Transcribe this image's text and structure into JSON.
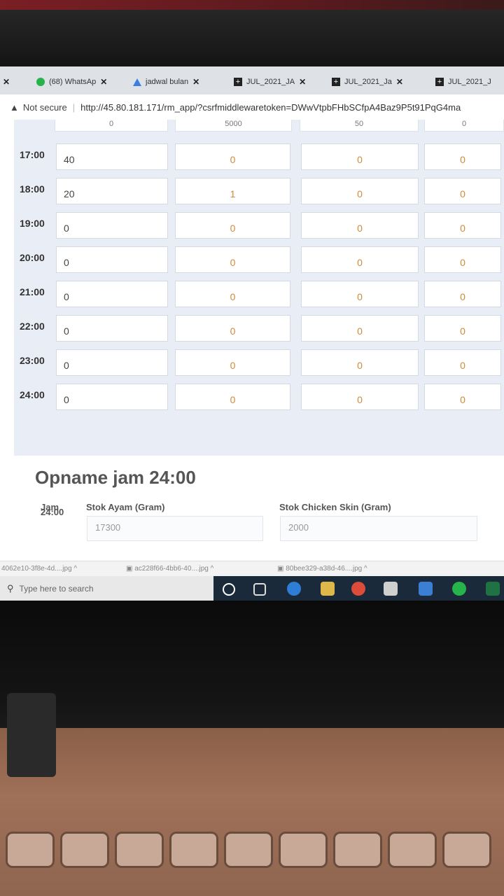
{
  "browser": {
    "tabs": [
      {
        "title": "(68) WhatsAp",
        "icon": "whatsapp-icon"
      },
      {
        "title": "jadwal bulan",
        "icon": "google-drive-icon"
      },
      {
        "title": "JUL_2021_JA",
        "icon": "plus-icon"
      },
      {
        "title": "JUL_2021_Ja",
        "icon": "plus-icon"
      },
      {
        "title": "JUL_2021_J",
        "icon": "plus-icon"
      }
    ],
    "security_label": "Not secure",
    "url": "http://45.80.181.171/rm_app/?csrfmiddlewaretoken=DWwVtpbFHbSCfpA4Baz9P5t91PqG4ma"
  },
  "table": {
    "partial_top_values": [
      "0",
      "5000",
      "50",
      "0"
    ],
    "rows": [
      {
        "time": "17:00",
        "values": [
          "40",
          "0",
          "0",
          "0"
        ]
      },
      {
        "time": "18:00",
        "values": [
          "20",
          "1",
          "0",
          "0"
        ]
      },
      {
        "time": "19:00",
        "values": [
          "0",
          "0",
          "0",
          "0"
        ]
      },
      {
        "time": "20:00",
        "values": [
          "0",
          "0",
          "0",
          "0"
        ]
      },
      {
        "time": "21:00",
        "values": [
          "0",
          "0",
          "0",
          "0"
        ]
      },
      {
        "time": "22:00",
        "values": [
          "0",
          "0",
          "0",
          "0"
        ]
      },
      {
        "time": "23:00",
        "values": [
          "0",
          "0",
          "0",
          "0"
        ]
      },
      {
        "time": "24:00",
        "values": [
          "0",
          "0",
          "0",
          "0"
        ]
      }
    ]
  },
  "opname": {
    "title": "Opname jam 24:00",
    "headers": {
      "jam": "Jam",
      "ayam": "Stok Ayam (Gram)",
      "skin": "Stok Chicken Skin (Gram)"
    },
    "row": {
      "jam": "24:00",
      "ayam": "17300",
      "skin": "2000"
    }
  },
  "downloads": [
    "4062e10-3f8e-4d....jpg",
    "ac228f66-4bb6-40....jpg",
    "80bee329-a38d-46....jpg"
  ],
  "taskbar": {
    "search_placeholder": "Type here to search"
  },
  "colors": {
    "accent_value": "#d08a3a",
    "grid_bg": "#e9edf6"
  }
}
